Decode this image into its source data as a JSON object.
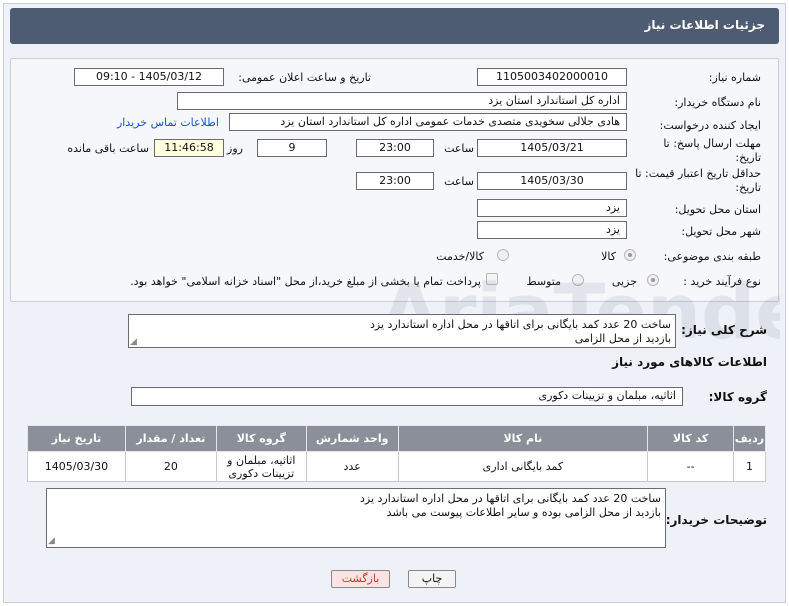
{
  "header": {
    "title": "جزئیات اطلاعات نیاز"
  },
  "form": {
    "need_number_label": "شماره نیاز:",
    "need_number": "1105003402000010",
    "announce_label": "تاریخ و ساعت اعلان عمومی:",
    "announce_value": "1405/03/12 - 09:10",
    "buyer_org_label": "نام دستگاه خریدار:",
    "buyer_org": "اداره کل استاندارد استان یزد",
    "requester_label": "ایجاد کننده درخواست:",
    "requester": "هادی جلالی سخویدی متصدی خدمات عمومی اداره کل استاندارد استان یزد",
    "contact_link": "اطلاعات تماس خریدار",
    "reply_deadline_label": "مهلت ارسال پاسخ: تا تاریخ:",
    "reply_date": "1405/03/21",
    "time_label": "ساعت",
    "reply_time": "23:00",
    "days_value": "9",
    "days_label": "روز و",
    "remaining_time": "11:46:58",
    "remaining_label": "ساعت باقی مانده",
    "price_validity_label": "حداقل تاریخ اعتبار قیمت: تا تاریخ:",
    "price_date": "1405/03/30",
    "price_time": "23:00",
    "province_label": "استان محل تحویل:",
    "province": "یزد",
    "city_label": "شهر محل تحویل:",
    "city": "یزد",
    "category_label": "طبقه بندی موضوعی:",
    "category_options": [
      "کالا",
      "کالا/خدمت"
    ],
    "process_label": "نوع فرآیند خرید :",
    "process_options": [
      "جزیی",
      "متوسط"
    ],
    "payment_note": "پرداخت تمام یا بخشی از مبلغ خرید،از محل \"اسناد خزانه اسلامی\" خواهد بود."
  },
  "summary": {
    "label": "شرح کلی نیاز:",
    "text": "ساخت 20 عدد کمد بایگانی برای اتاقها در محل اداره استاندارد یزد\nبازدید از محل الزامی"
  },
  "goods": {
    "section_title": "اطلاعات کالاهای مورد نیاز",
    "group_label": "گروه کالا:",
    "group_value": "اثاثیه، مبلمان و تزیینات دکوری"
  },
  "table": {
    "headers": [
      "ردیف",
      "کد کالا",
      "نام کالا",
      "واحد شمارش",
      "گروه کالا",
      "تعداد / مقدار",
      "تاریخ نیاز"
    ],
    "rows": [
      [
        "1",
        "--",
        "کمد بایگانی اداری",
        "عدد",
        "اثاثیه، مبلمان و تزیینات دکوری",
        "20",
        "1405/03/30"
      ]
    ]
  },
  "buyer_notes": {
    "label": "توضیحات خریدار:",
    "text": "ساخت 20 عدد کمد بایگانی برای اتاقها در محل اداره استاندارد یزد\nبازدید از محل الزامی بوده و سایر اطلاعات پیوست می باشد"
  },
  "buttons": {
    "print": "چاپ",
    "back": "بازگشت"
  },
  "colors": {
    "header_bg": "#4d5b73",
    "link": "#1b4fd6",
    "back_text": "#c0392b",
    "table_header": "#8a8f99"
  }
}
